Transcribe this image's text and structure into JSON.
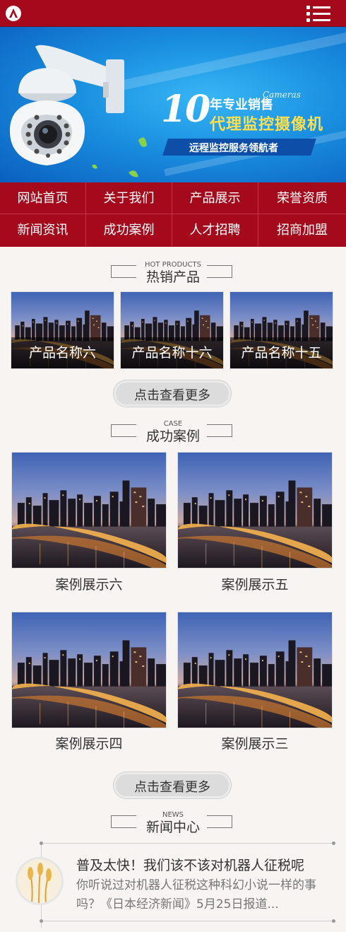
{
  "header": {
    "logo_icon": "logo-a-icon",
    "menu_icon": "menu-icon"
  },
  "banner": {
    "slogan_number": "10",
    "slogan_top": "年专业销售",
    "slogan_script": "Cameras",
    "slogan_main": "代理监控摄像机",
    "slogan_sub": "远程监控服务领航者",
    "slide_count": 3,
    "active_slide": 0
  },
  "nav": {
    "items": [
      {
        "label": "网站首页"
      },
      {
        "label": "关于我们"
      },
      {
        "label": "产品展示"
      },
      {
        "label": "荣誉资质"
      },
      {
        "label": "新闻资讯"
      },
      {
        "label": "成功案例"
      },
      {
        "label": "人才招聘"
      },
      {
        "label": "招商加盟"
      }
    ]
  },
  "products": {
    "title_en": "HOT PRODUCTS",
    "title_cn": "热销产品",
    "items": [
      {
        "name": "产品名称六"
      },
      {
        "name": "产品名称十六"
      },
      {
        "name": "产品名称十五"
      }
    ],
    "more_label": "点击查看更多"
  },
  "cases": {
    "title_en": "CASE",
    "title_cn": "成功案例",
    "items": [
      {
        "name": "案例展示六"
      },
      {
        "name": "案例展示五"
      },
      {
        "name": "案例展示四"
      },
      {
        "name": "案例展示三"
      }
    ],
    "more_label": "点击查看更多"
  },
  "news": {
    "title_en": "NEWS",
    "title_cn": "新闻中心",
    "items": [
      {
        "title": "普及太快！我们该不该对机器人征税呢",
        "summary": "你听说过对机器人征税这种科幻小说一样的事吗？《日本经济新闻》5月25日报道..."
      }
    ]
  },
  "colors": {
    "brand": "#a50a1c",
    "banner_blue": "#1a8fe0",
    "accent_yellow": "#ffe04a",
    "active_dot": "#f06b5c"
  }
}
